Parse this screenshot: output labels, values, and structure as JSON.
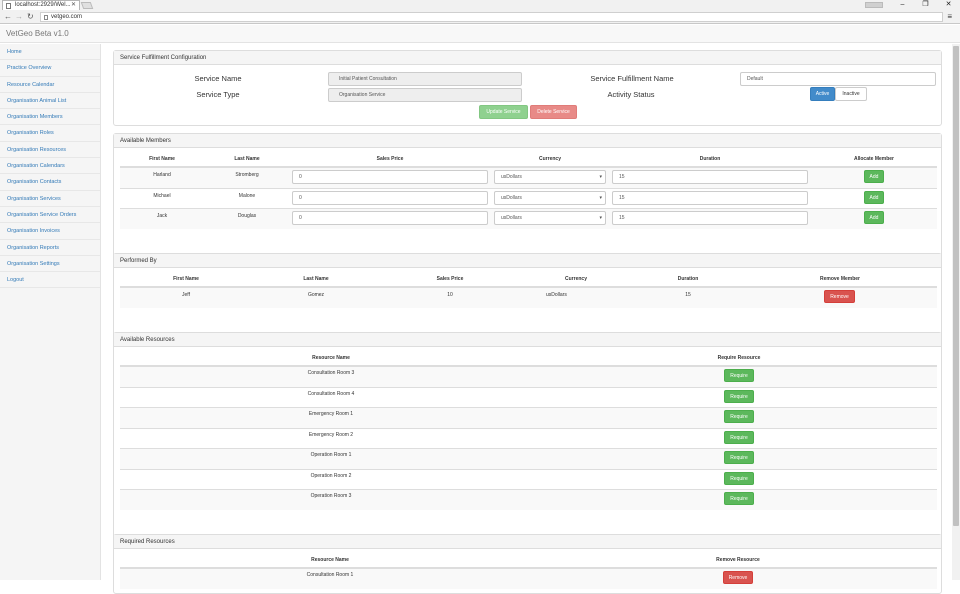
{
  "browser": {
    "tab_title": "localhost:2929/Wel...",
    "url": "vetgeo.com"
  },
  "app": {
    "brand": "VetGeo Beta v1.0"
  },
  "sidebar": {
    "items": [
      "Home",
      "Practice Overview",
      "Resource Calendar",
      "Organisation Animal List",
      "Organisation Members",
      "Organisation Roles",
      "Organisation Resources",
      "Organisation Calendars",
      "Organisation Contacts",
      "Organisation Services",
      "Organisation Service Orders",
      "Organisation Invoices",
      "Organisation Reports",
      "Organisation Settings",
      "Logout"
    ]
  },
  "config": {
    "title": "Service Fulfillment Configuration",
    "service_name_label": "Service Name",
    "service_name": "Initial Patient Consultation",
    "service_type_label": "Service Type",
    "service_type": "Organisation Service",
    "fulfillment_name_label": "Service Fulfillment Name",
    "fulfillment_name": "Default",
    "activity_status_label": "Activity Status",
    "active_label": "Active",
    "inactive_label": "Inactive",
    "update_label": "Update Service",
    "delete_label": "Delete Service"
  },
  "available_members": {
    "title": "Available Members",
    "headers": [
      "First Name",
      "Last Name",
      "Sales Price",
      "Currency",
      "Duration",
      "Allocate Member"
    ],
    "rows": [
      {
        "first": "Harland",
        "last": "Stromberg",
        "price": "0",
        "currency": "usDollars",
        "duration": "15",
        "action": "Add"
      },
      {
        "first": "Michael",
        "last": "Malone",
        "price": "0",
        "currency": "usDollars",
        "duration": "15",
        "action": "Add"
      },
      {
        "first": "Jack",
        "last": "Douglas",
        "price": "0",
        "currency": "usDollars",
        "duration": "15",
        "action": "Add"
      }
    ]
  },
  "performed_by": {
    "title": "Performed By",
    "headers": [
      "First Name",
      "Last Name",
      "Sales Price",
      "Currency",
      "Duration",
      "Remove Member"
    ],
    "rows": [
      {
        "first": "Jeff",
        "last": "Gomez",
        "price": "10",
        "currency": "usDollars",
        "duration": "15",
        "action": "Remove"
      }
    ]
  },
  "available_resources": {
    "title": "Available Resources",
    "headers": [
      "Resource Name",
      "Require Resource"
    ],
    "rows": [
      {
        "name": "Consultation Room 3",
        "action": "Require"
      },
      {
        "name": "Consultation Room 4",
        "action": "Require"
      },
      {
        "name": "Emergency Room 1",
        "action": "Require"
      },
      {
        "name": "Emergency Room 2",
        "action": "Require"
      },
      {
        "name": "Operation Room 1",
        "action": "Require"
      },
      {
        "name": "Operation Room 2",
        "action": "Require"
      },
      {
        "name": "Operation Room 3",
        "action": "Require"
      }
    ]
  },
  "required_resources": {
    "title": "Required Resources",
    "headers": [
      "Resource Name",
      "Remove Resource"
    ],
    "rows": [
      {
        "name": "Consultation Room 1",
        "action": "Remove"
      }
    ]
  }
}
